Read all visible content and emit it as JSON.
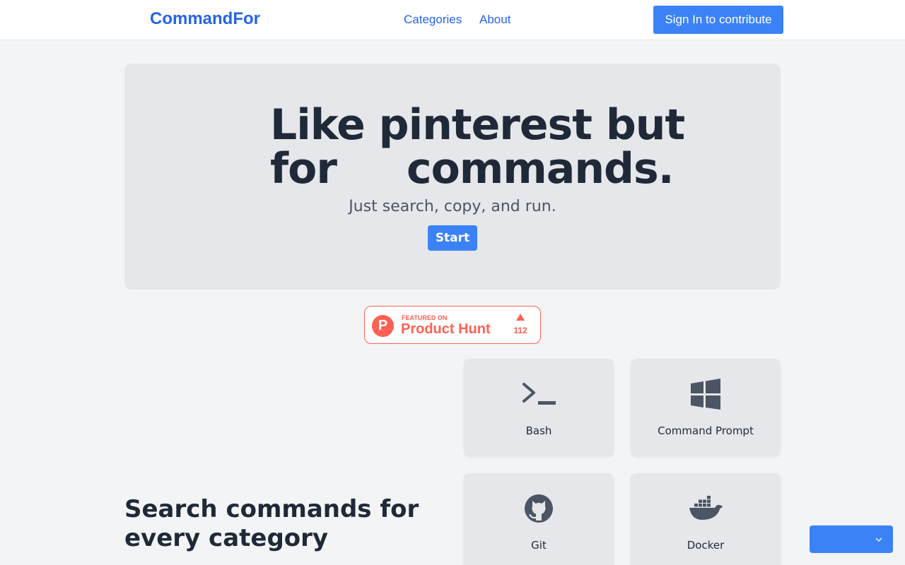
{
  "nav": {
    "brand": "CommandFor",
    "links": [
      "Categories",
      "About"
    ],
    "signin_label": "Sign In to contribute"
  },
  "hero": {
    "line1": "Like pinterest but",
    "line2_start": "for",
    "line2_end": "commands.",
    "tagline": "Just search, copy, and run.",
    "start_label": "Start"
  },
  "producthunt": {
    "featured": "FEATURED ON",
    "name": "Product Hunt",
    "logo_letter": "P",
    "count": "112",
    "color": "#ff6154"
  },
  "section": {
    "heading_line1": "Search commands for",
    "heading_line2": "every category"
  },
  "categories": [
    {
      "label": "Bash",
      "icon": "terminal-icon"
    },
    {
      "label": "Command Prompt",
      "icon": "windows-icon"
    },
    {
      "label": "Git",
      "icon": "github-icon"
    },
    {
      "label": "Docker",
      "icon": "docker-icon"
    }
  ],
  "colors": {
    "accent": "#3b82f6",
    "brand": "#2563eb",
    "text": "#1f2937",
    "icon": "#4b5563"
  }
}
